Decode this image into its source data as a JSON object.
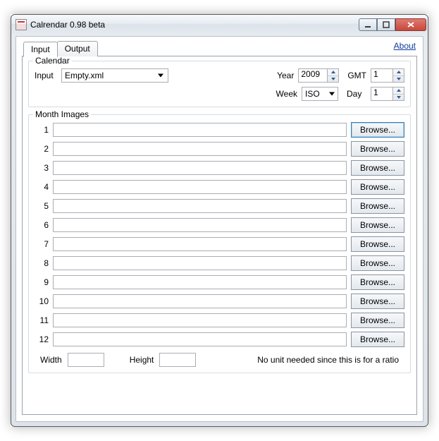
{
  "window": {
    "title": "Calrendar 0.98 beta"
  },
  "controls": {
    "min_title": "Minimize",
    "max_title": "Maximize",
    "close_title": "Close"
  },
  "about_link": "About",
  "tabs": {
    "input": "Input",
    "output": "Output"
  },
  "calendar_group": {
    "title": "Calendar",
    "input_label": "Input",
    "input_value": "Empty.xml",
    "year_label": "Year",
    "year_value": "2009",
    "gmt_label": "GMT",
    "gmt_value": "1",
    "week_label": "Week",
    "week_value": "ISO",
    "day_label": "Day",
    "day_value": "1"
  },
  "month_group": {
    "title": "Month Images",
    "rows": [
      {
        "n": "1",
        "path": "",
        "browse": "Browse..."
      },
      {
        "n": "2",
        "path": "",
        "browse": "Browse..."
      },
      {
        "n": "3",
        "path": "",
        "browse": "Browse..."
      },
      {
        "n": "4",
        "path": "",
        "browse": "Browse..."
      },
      {
        "n": "5",
        "path": "",
        "browse": "Browse..."
      },
      {
        "n": "6",
        "path": "",
        "browse": "Browse..."
      },
      {
        "n": "7",
        "path": "",
        "browse": "Browse..."
      },
      {
        "n": "8",
        "path": "",
        "browse": "Browse..."
      },
      {
        "n": "9",
        "path": "",
        "browse": "Browse..."
      },
      {
        "n": "10",
        "path": "",
        "browse": "Browse..."
      },
      {
        "n": "11",
        "path": "",
        "browse": "Browse..."
      },
      {
        "n": "12",
        "path": "",
        "browse": "Browse..."
      }
    ],
    "width_label": "Width",
    "width_value": "",
    "height_label": "Height",
    "height_value": "",
    "ratio_note": "No unit needed since this is for a ratio"
  }
}
